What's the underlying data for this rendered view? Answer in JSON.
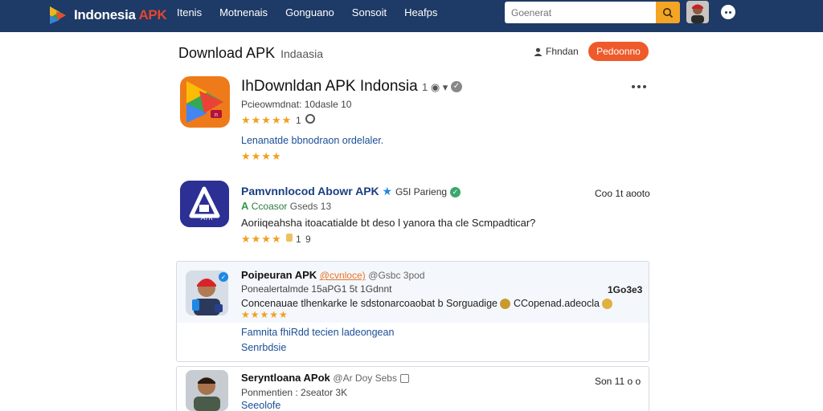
{
  "header": {
    "brand_name": "Indonesia",
    "brand_suffix": "APK",
    "nav": [
      "Itenis",
      "Motnenais",
      "Gonguano",
      "Sonsoit",
      "Heafps"
    ],
    "search_placeholder": "Goenerat"
  },
  "page": {
    "title": "Download APK",
    "subtitle": "Indaasia",
    "user_link": "Fhndan",
    "action_button": "Pedoonno"
  },
  "app1": {
    "title": "IhDownldan APK Indonsia",
    "meta": "Pcieowmdnat: 10dasle 10",
    "rating_count": "1",
    "stars": "★★★★★",
    "link": "Lenanatde bbnodraon ordelaler.",
    "stars2": "★★★★"
  },
  "app2": {
    "title": "Pamvnnlocod Abowr APK",
    "title_tail": "G5I Parieng",
    "right_meta": "Coo 1t aooto",
    "tag_label": "A",
    "tag_text": "Ccoasor",
    "tag_tail": "Gseds 13",
    "description": "Aoriiqeahsha itoacatialde bt deso l yanora tha cle Scmpadticar?",
    "stars": "★★★★",
    "rating": "1",
    "rating2": "9",
    "icon_text": "ATK"
  },
  "review1": {
    "name": "Poipeuran APK",
    "handle": "@cvnloce)",
    "handle_tail": "@Gsbc 3pod",
    "meta": "Ponealertalmde 15aPG1 5t 1Gdnnt",
    "right_value": "1Go3e3",
    "text": "Concenauae tlhenkarke le sdstonarcoaobat b Sorguadige",
    "text_tail": "CCopenad.adeocla",
    "stars": "★★★★★",
    "link1": "Famnita fhiRdd tecien ladeongean",
    "link2": "Senrbdsie"
  },
  "review2": {
    "name": "Seryntloana APok",
    "handle_tail": "@Ar Doy Sebs",
    "meta": "Ponmentien : 2seator 3K",
    "link": "Seeolofe",
    "right_meta": "Son 11 o o"
  }
}
